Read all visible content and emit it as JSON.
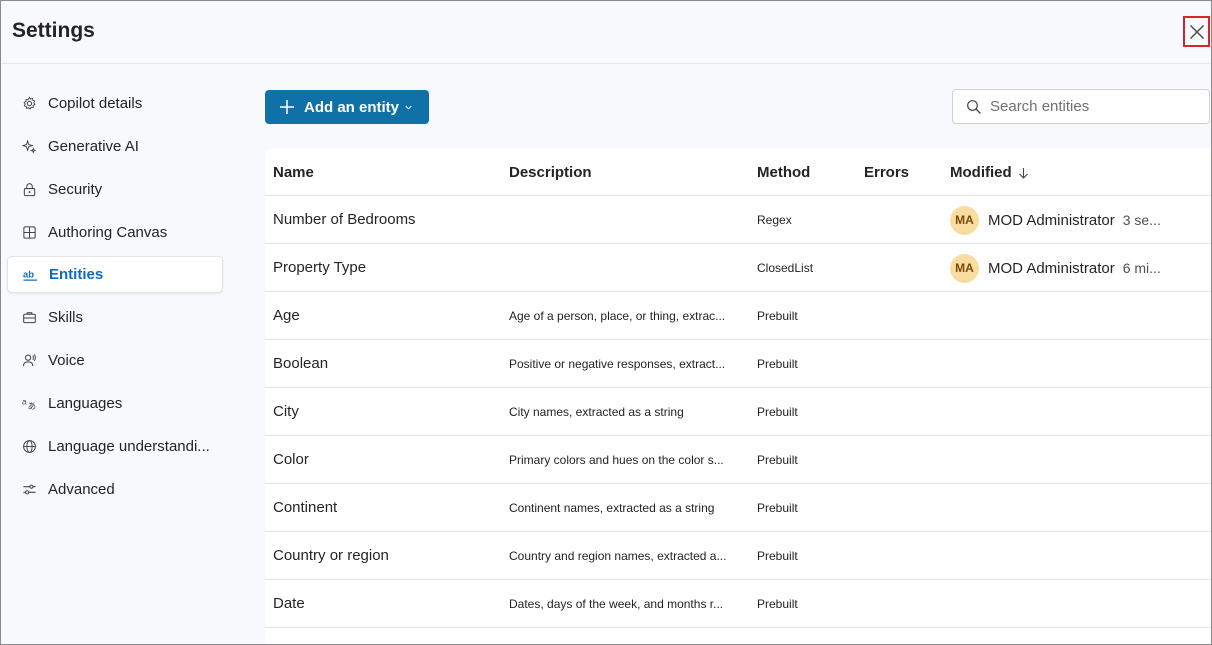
{
  "header": {
    "title": "Settings"
  },
  "sidebar": {
    "items": [
      {
        "label": "Copilot details",
        "icon": "gear-icon"
      },
      {
        "label": "Generative AI",
        "icon": "sparkle-icon"
      },
      {
        "label": "Security",
        "icon": "lock-icon"
      },
      {
        "label": "Authoring Canvas",
        "icon": "grid-icon"
      },
      {
        "label": "Entities",
        "icon": "text-ab-icon",
        "active": true
      },
      {
        "label": "Skills",
        "icon": "briefcase-icon"
      },
      {
        "label": "Voice",
        "icon": "person-voice-icon"
      },
      {
        "label": "Languages",
        "icon": "translate-icon"
      },
      {
        "label": "Language understandi...",
        "icon": "globe-icon"
      },
      {
        "label": "Advanced",
        "icon": "sliders-icon"
      }
    ]
  },
  "toolbar": {
    "add_label": "Add an entity"
  },
  "search": {
    "placeholder": "Search entities"
  },
  "table": {
    "columns": {
      "name": "Name",
      "description": "Description",
      "method": "Method",
      "errors": "Errors",
      "modified": "Modified"
    },
    "rows": [
      {
        "name": "Number of Bedrooms",
        "description": "",
        "method": "Regex",
        "avatar": "MA",
        "modified_by": "MOD Administrator",
        "modified_time": "3 se..."
      },
      {
        "name": "Property Type",
        "description": "",
        "method": "ClosedList",
        "avatar": "MA",
        "modified_by": "MOD Administrator",
        "modified_time": "6 mi..."
      },
      {
        "name": "Age",
        "description": "Age of a person, place, or thing, extrac...",
        "method": "Prebuilt"
      },
      {
        "name": "Boolean",
        "description": "Positive or negative responses, extract...",
        "method": "Prebuilt"
      },
      {
        "name": "City",
        "description": "City names, extracted as a string",
        "method": "Prebuilt"
      },
      {
        "name": "Color",
        "description": "Primary colors and hues on the color s...",
        "method": "Prebuilt"
      },
      {
        "name": "Continent",
        "description": "Continent names, extracted as a string",
        "method": "Prebuilt"
      },
      {
        "name": "Country or region",
        "description": "Country and region names, extracted a...",
        "method": "Prebuilt"
      },
      {
        "name": "Date",
        "description": "Dates, days of the week, and months r...",
        "method": "Prebuilt"
      }
    ]
  },
  "colors": {
    "accent": "#1070a8",
    "active_nav": "#0f6cbd",
    "close_highlight": "#d9232b",
    "avatar_bg": "#f8dca0"
  }
}
